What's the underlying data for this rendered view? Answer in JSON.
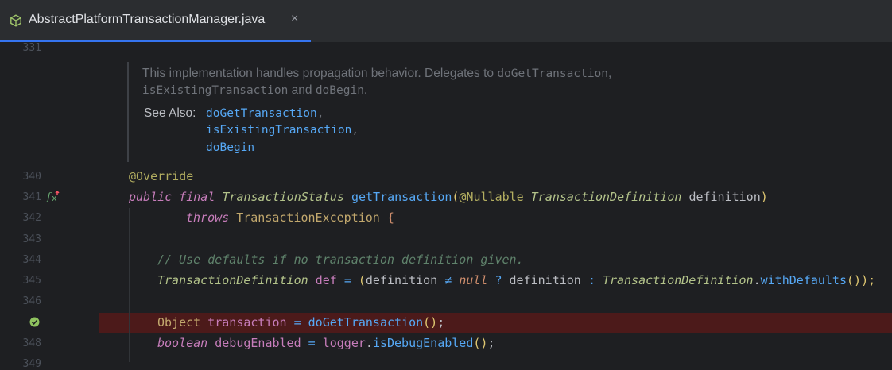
{
  "tab": {
    "title": "AbstractPlatformTransactionManager.java",
    "close": "×"
  },
  "gutter": {
    "line_numbers": [
      "331",
      "340",
      "341",
      "342",
      "343",
      "344",
      "345",
      "346",
      "348",
      "349"
    ]
  },
  "doc": {
    "line1_prefix": "This implementation handles propagation behavior. Delegates to ",
    "line1_code": "doGetTransaction",
    "line1_suffix": ",",
    "line2_code1": "isExistingTransaction",
    "line2_mid": " and ",
    "line2_code2": "doBegin",
    "line2_suffix": ".",
    "see_also_label": "See Also:",
    "see_also_links": [
      "doGetTransaction",
      "isExistingTransaction",
      "doBegin"
    ],
    "comma": ","
  },
  "code": {
    "l340_ann": "@Override",
    "l341": {
      "kw1": "public",
      "kw2": "final",
      "type": "TransactionStatus",
      "fn": "getTransaction",
      "paren_open": "(",
      "ann": "@Nullable",
      "ptype": "TransactionDefinition",
      "pname": "definition",
      "paren_close": ")"
    },
    "l342": {
      "kw": "throws",
      "type": "TransactionException",
      "brace": "{"
    },
    "l344_comment": "// Use defaults if no transaction definition given.",
    "l345": {
      "type": "TransactionDefinition",
      "var": "def",
      "eq": "=",
      "paren_open": "(",
      "name": "definition",
      "neq": "≠",
      "null": "null",
      "q": "?",
      "name2": "definition",
      "colon": ":",
      "type2": "TransactionDefinition",
      "dot": ".",
      "fn": "withDefaults",
      "call": "()",
      "end": ");"
    },
    "l347": {
      "type": "Object",
      "var": "transaction",
      "eq": "=",
      "fn": "doGetTransaction",
      "call": "()",
      "semi": ";"
    },
    "l348": {
      "type": "boolean",
      "var": "debugEnabled",
      "eq": "=",
      "obj": "logger",
      "dot": ".",
      "fn": "isDebugEnabled",
      "call": "()",
      "semi": ";"
    }
  },
  "colors": {
    "accent": "#3574f0",
    "breakpoint_line": "#4c1a1a",
    "background": "#1e1f22"
  },
  "icons": [
    "java-class-icon",
    "override-method-icon",
    "breakpoint-check-icon"
  ]
}
